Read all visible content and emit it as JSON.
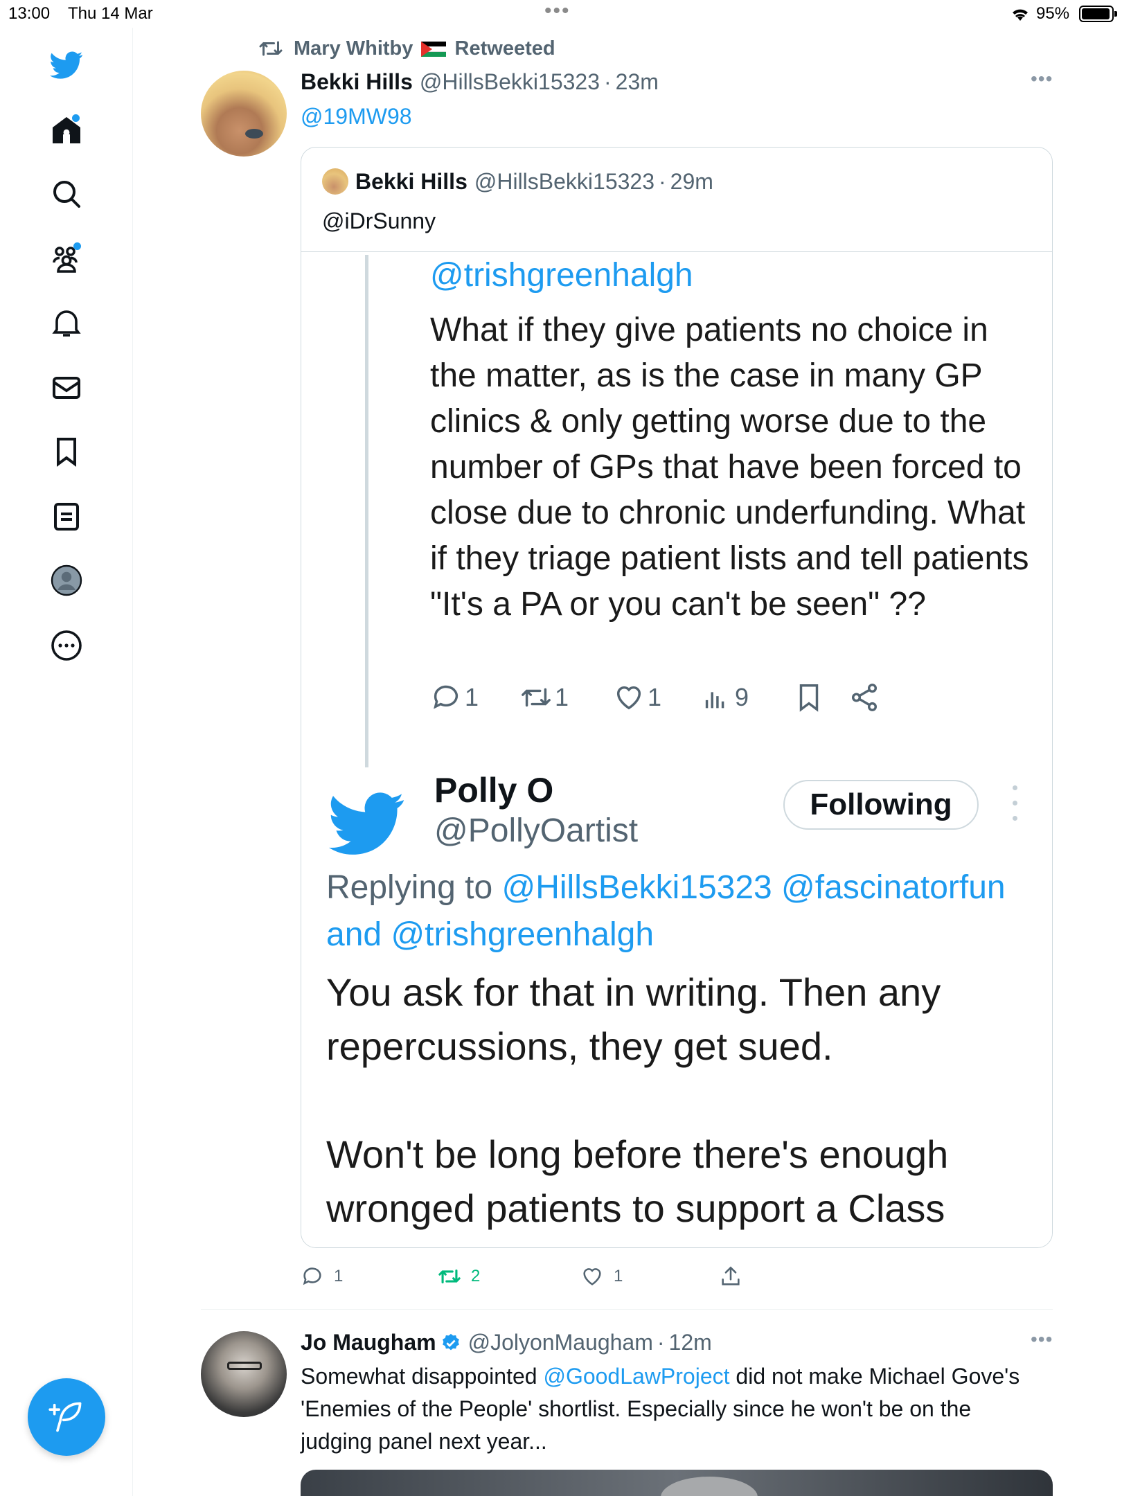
{
  "status_bar": {
    "time": "13:00",
    "date": "Thu 14 Mar",
    "battery": "95%"
  },
  "sidebar": {
    "items": [
      {
        "name": "twitter-logo-icon"
      },
      {
        "name": "home-icon"
      },
      {
        "name": "search-icon"
      },
      {
        "name": "communities-icon"
      },
      {
        "name": "notifications-icon"
      },
      {
        "name": "messages-icon"
      },
      {
        "name": "bookmarks-icon"
      },
      {
        "name": "lists-icon"
      },
      {
        "name": "profile-icon"
      },
      {
        "name": "more-icon"
      }
    ],
    "compose_icon": "compose-feather-icon"
  },
  "retweet_tweet": {
    "retweeted_by": "Mary Whitby",
    "retweeted_label": "Retweeted",
    "author_name": "Bekki Hills",
    "author_handle": "@HillsBekki15323",
    "time": "23m",
    "text": "@19MW98",
    "quote": {
      "author_name": "Bekki Hills",
      "author_handle": "@HillsBekki15323",
      "time": "29m",
      "text": "@iDrSunny",
      "image": {
        "mention": "@trishgreenhalgh",
        "text": "What if they give patients no choice in the matter, as is the case in many GP clinics & only getting worse due to the number of GPs that have been forced to close due to chronic underfunding. What if they triage patient lists and tell patients \"It's a PA or you can't be seen\" ??",
        "replies": "1",
        "retweets": "1",
        "likes": "1",
        "views": "9",
        "reply_author_name": "Polly O",
        "reply_author_handle": "@PollyOartist",
        "follow_button": "Following",
        "replying_prefix": "Replying to",
        "replying_mentions": "@HillsBekki15323 @fascinatorfun",
        "replying_and": "and",
        "replying_last": "@trishgreenhalgh",
        "reply_text": "You ask for that in writing.  Then any repercussions, they get sued.\n\nWon't be long before there's enough wronged patients to support a Class"
      }
    },
    "stats": {
      "replies": "1",
      "retweets": "2",
      "likes": "1"
    }
  },
  "second_tweet": {
    "author_name": "Jo Maugham",
    "author_handle": "@JolyonMaugham",
    "time": "12m",
    "text_before": "Somewhat disappointed ",
    "mention": "@GoodLawProject",
    "text_after": " did not make Michael Gove's 'Enemies of the People' shortlist. Especially since he won't be on the judging panel next year..."
  },
  "colors": {
    "accent": "#1d9bf0",
    "retweet_active": "#00ba7c",
    "muted_text": "#536471"
  }
}
